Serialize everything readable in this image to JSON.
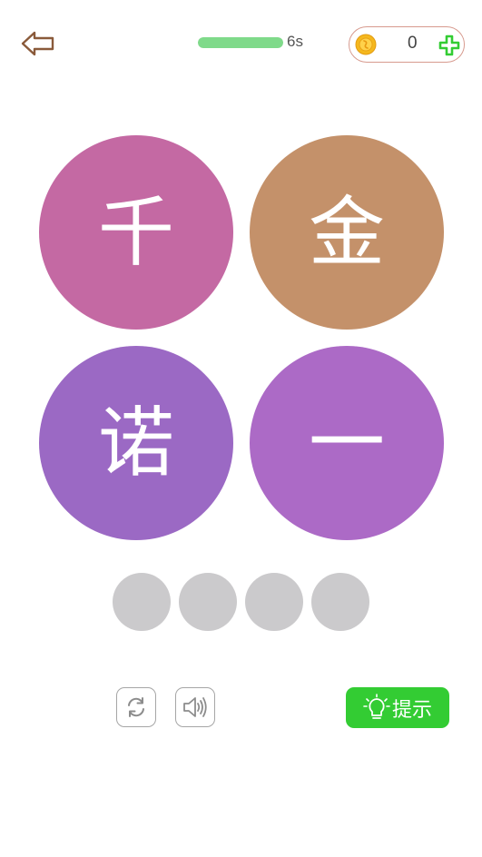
{
  "header": {
    "back_icon": "back-arrow-icon",
    "timer": {
      "remaining_label": "6s",
      "progress": 1.0,
      "color": "#7fda8a"
    },
    "coins": {
      "count": "0",
      "coin_icon": "coin-icon",
      "add_icon": "plus-icon",
      "add_color": "#33cc33"
    }
  },
  "tiles": [
    {
      "char": "千",
      "color": "#c469a3"
    },
    {
      "char": "金",
      "color": "#c4916a"
    },
    {
      "char": "诺",
      "color": "#9b69c4"
    },
    {
      "char": "一",
      "color": "#ac6ac6"
    }
  ],
  "answer_slots": [
    "",
    "",
    "",
    ""
  ],
  "controls": {
    "refresh_icon": "refresh-icon",
    "sound_icon": "speaker-icon",
    "hint": {
      "label": "提示",
      "icon": "lightbulb-icon",
      "color": "#33cc33"
    }
  }
}
